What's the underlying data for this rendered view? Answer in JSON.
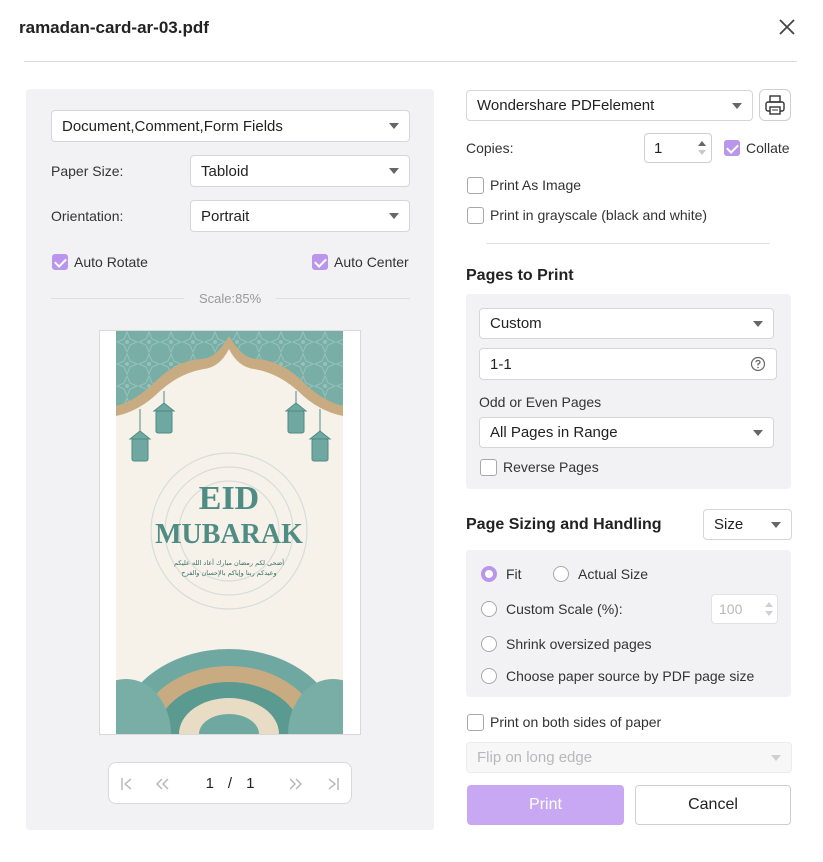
{
  "window": {
    "title": "ramadan-card-ar-03.pdf"
  },
  "left": {
    "print_what": "Document,Comment,Form Fields",
    "paper_size_label": "Paper Size:",
    "paper_size_value": "Tabloid",
    "orientation_label": "Orientation:",
    "orientation_value": "Portrait",
    "auto_rotate": "Auto Rotate",
    "auto_center": "Auto Center",
    "scale_text": "Scale:85%",
    "card": {
      "line1": "EID",
      "line2": "MUBARAK",
      "arabic1": "أضحى لكم رمضان مبارك أعاد الله عليكم",
      "arabic2": "وعيدكم ربنا وإياكم بالإحسان والفرح"
    },
    "pager": {
      "current": "1",
      "separator": "/",
      "total": "1"
    }
  },
  "right": {
    "printer": "Wondershare PDFelement",
    "copies_label": "Copies:",
    "copies_value": "1",
    "collate": "Collate",
    "print_as_image": "Print As Image",
    "grayscale": "Print in grayscale (black and white)",
    "pages_title": "Pages to Print",
    "pages_mode": "Custom",
    "pages_range": "1-1",
    "odd_even_label": "Odd or Even Pages",
    "odd_even_value": "All Pages in Range",
    "reverse": "Reverse Pages",
    "sizing_title": "Page Sizing and Handling",
    "sizing_mode": "Size",
    "fit": "Fit",
    "actual_size": "Actual Size",
    "custom_scale": "Custom Scale (%):",
    "custom_scale_value": "100",
    "shrink": "Shrink oversized pages",
    "paper_source": "Choose paper source by PDF page size",
    "both_sides": "Print on both sides of paper",
    "flip": "Flip on long edge",
    "print_btn": "Print",
    "cancel_btn": "Cancel"
  },
  "colors": {
    "accent": "#b996ec",
    "print_button": "#c9a8f3",
    "panel": "#f2f2f4",
    "teal": "#6fa8a0"
  }
}
